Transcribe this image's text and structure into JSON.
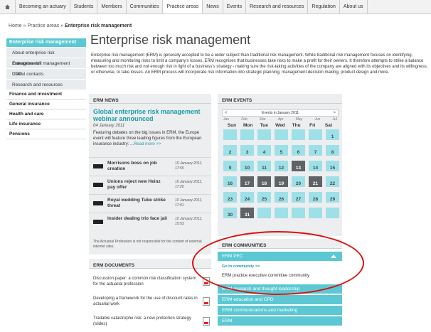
{
  "topnav": {
    "tabs": [
      "Becoming an actuary",
      "Students",
      "Members",
      "Communities",
      "Practice areas",
      "News",
      "Events",
      "Research and resources",
      "Regulation",
      "About us"
    ],
    "active": "Practice areas"
  },
  "breadcrumb": {
    "home": "Home",
    "sep": "»",
    "practice": "Practice areas",
    "current": "Enterprise risk management"
  },
  "leftnav": {
    "section": "Enterprise risk management",
    "subitems": [
      "About enterprise risk management?",
      "Enterprise risk management CPD",
      "Useful contacts",
      "Research and resources"
    ],
    "main": [
      "Finance and investment",
      "General insurance",
      "Health and care",
      "Life insurance",
      "Pensions"
    ]
  },
  "page": {
    "title": "Enterprise risk management",
    "intro": "Enterprise risk management (ERM) is generally accepted to be a wider subject than traditional risk management. While traditional risk management focuses on identifying, measuring and monitoring risks to limit a company's losses, ERM recognises that businesses take risks to make a profit for their owners. It therefore attempts to strike a balance between too much risk and not enough risk in light of a business's strategy - making sure the risk-taking activities of the company are aligned with its objectives and its willingness, or otherwise, to take losses. An ERM process will incorporate risk information into strategic planning, management decision making, product design and more."
  },
  "news": {
    "header": "ERM NEWS",
    "feature": {
      "title": "Global enterprise risk management webinar announced",
      "date": "04 January 2011",
      "text": "Featuring debates on the big issues in ERM, the Europe event will feature three leading figures from the European insurance industry: ...",
      "more": "Read more >>"
    },
    "items": [
      {
        "title": "Morrisons boss on job creation",
        "date": "10 January 2011, 17:55"
      },
      {
        "title": "Unions reject new Heinz pay offer",
        "date": "10 January 2011, 17:20"
      },
      {
        "title": "Royal wedding Tube strike threat",
        "date": "10 January 2011, 17:01"
      },
      {
        "title": "Insider dealing trio face jail",
        "date": "10 January 2011, 15:53"
      }
    ],
    "disclaimer": "The Actuarial Profession is not responsible for the content of external internet sites."
  },
  "docs": {
    "header": "ERM DOCUMENTS",
    "items": [
      "Discussion paper: a common risk classification system for the actuarial profession",
      "Developing a framework for the use of discount rates in actuarial work",
      "Tradable catastrophe risk: a new protection strategy (slides)"
    ]
  },
  "events": {
    "header": "ERM EVENTS",
    "calendar_title": "Events in January 2011",
    "prev": "<",
    "next": ">",
    "months": [
      "Jan",
      "Feb",
      "Mar",
      "Apr",
      "May",
      "Jun",
      "Jul"
    ],
    "days": [
      "Sun",
      "Mon",
      "Tue",
      "Wed",
      "Thu",
      "Fri",
      "Sat"
    ],
    "cells": [
      "",
      "",
      "",
      "",
      "",
      "",
      "1",
      "2",
      "3",
      "4",
      "5",
      "6",
      "7",
      "8",
      "9",
      "10",
      "11",
      "12",
      "13",
      "14",
      "15",
      "16",
      "17",
      "18",
      "19",
      "20",
      "21",
      "22",
      "23",
      "24",
      "25",
      "26",
      "27",
      "28",
      "29",
      "30",
      "31",
      "",
      "",
      "",
      "",
      ""
    ],
    "event_days": [
      "13",
      "17",
      "18",
      "19",
      "21",
      "31"
    ]
  },
  "communities": {
    "header": "ERM COMMUNITIES",
    "open": "ERM PEC",
    "goto": "Go to community >>",
    "open_desc": "ERM practice executive committee community",
    "others": [
      "ERM research and thought leadership",
      "ERM education and CPD",
      "ERM communications and marketing",
      "ERM"
    ]
  },
  "colors": {
    "accent": "#5bc8d3",
    "link": "#1a9aa6",
    "event_day": "#5f6366",
    "annotation": "#dd1111"
  }
}
